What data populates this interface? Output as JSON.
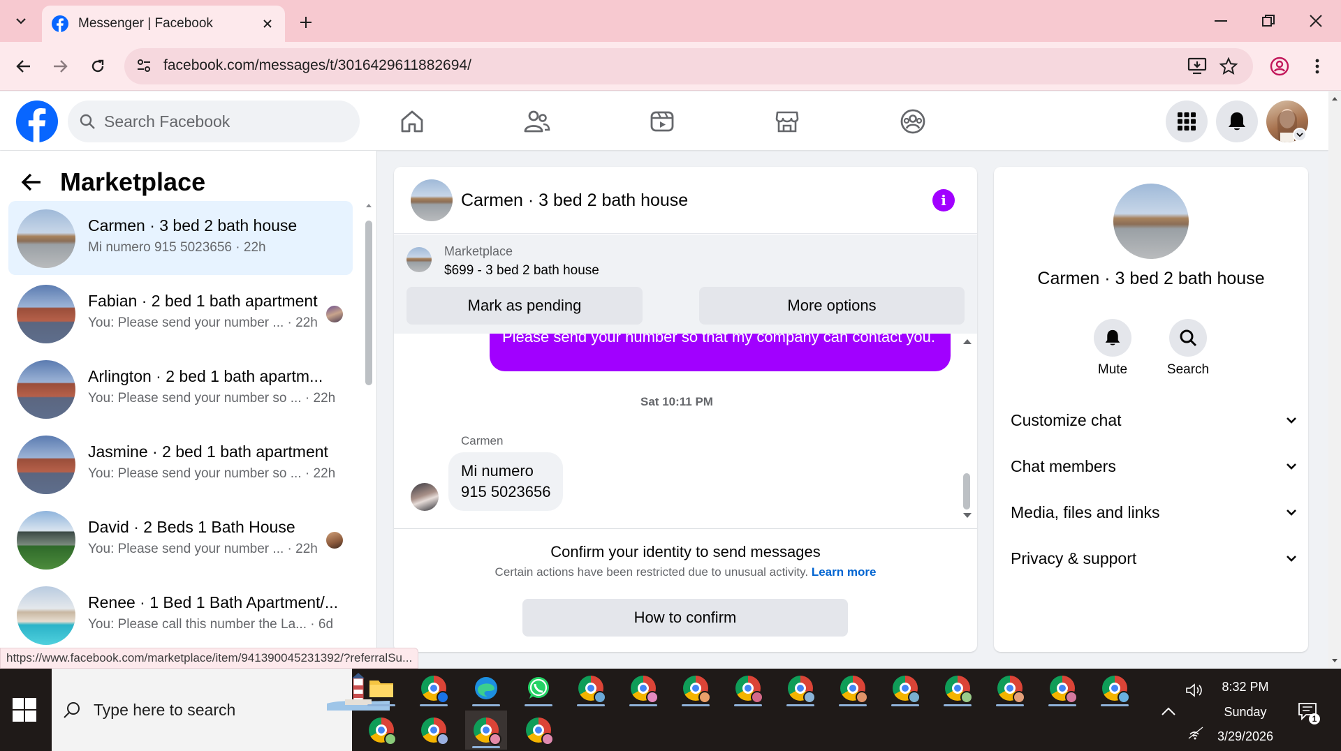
{
  "browser": {
    "tab_title": "Messenger | Facebook",
    "url": "facebook.com/messages/t/3016429611882694/",
    "status_url": "https://www.facebook.com/marketplace/item/941390045231392/?referralSu..."
  },
  "fb_header": {
    "search_placeholder": "Search Facebook",
    "nav": [
      "home-icon",
      "friends-icon",
      "video-icon",
      "marketplace-icon",
      "groups-icon"
    ],
    "right": [
      "menu-grid-icon",
      "bell-icon",
      "profile-avatar"
    ]
  },
  "sidebar": {
    "title": "Marketplace",
    "chats": [
      {
        "name": "Carmen · 3 bed 2 bath house",
        "preview": "Mi numero 915 5023656",
        "time": "· 22h"
      },
      {
        "name": "Fabian · 2 bed 1 bath apartment",
        "preview": "You: Please send your number ...",
        "time": "· 22h"
      },
      {
        "name": "Arlington · 2 bed 1 bath apartm...",
        "preview": "You: Please send your number so ...",
        "time": "· 22h"
      },
      {
        "name": "Jasmine · 2 bed 1 bath apartment",
        "preview": "You: Please send your number so ...",
        "time": "· 22h"
      },
      {
        "name": "David · 2 Beds 1 Bath House",
        "preview": "You: Please send your number ...",
        "time": "· 22h"
      },
      {
        "name": "Renee · 1 Bed 1 Bath Apartment/...",
        "preview": "You: Please call this number the La...",
        "time": "· 6d"
      }
    ]
  },
  "conversation": {
    "title": "Carmen · 3 bed 2 bath house",
    "listing": {
      "label": "Marketplace",
      "price_title": "$699 - 3 bed 2 bath house",
      "mark_pending": "Mark as pending",
      "more_options": "More options"
    },
    "outgoing_text": "Please send your number so that my company can contact you.",
    "timestamp": "Sat 10:11 PM",
    "sender": "Carmen",
    "incoming_line1": "Mi numero",
    "incoming_line2": "915 5023656",
    "confirm_title": "Confirm your identity to send messages",
    "confirm_text": "Certain actions have been restricted due to unusual activity.",
    "learn_more": "Learn more",
    "confirm_button": "How to confirm"
  },
  "info_panel": {
    "name": "Carmen · 3 bed 2 bath house",
    "mute": "Mute",
    "search": "Search",
    "rows": [
      "Customize chat",
      "Chat members",
      "Media, files and links",
      "Privacy & support"
    ]
  },
  "taskbar": {
    "search_placeholder": "Type here to search",
    "time": "8:32 PM",
    "day": "Sunday",
    "date": "3/29/2026",
    "notification_count": "1"
  },
  "colors": {
    "brand": "#0866ff",
    "messenger_purple": "#a100ff",
    "active_chat": "#e7f3ff"
  }
}
